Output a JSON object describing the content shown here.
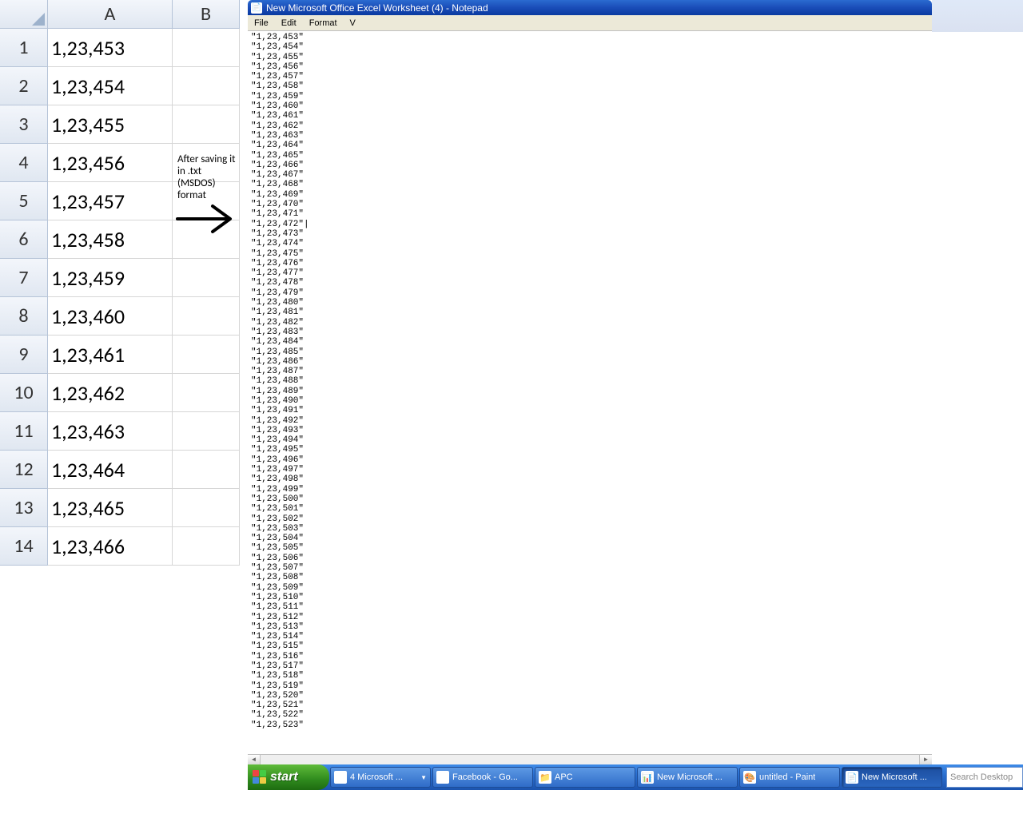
{
  "excel": {
    "columns": [
      "A",
      "B"
    ],
    "rows": [
      {
        "n": "1",
        "A": "1,23,453"
      },
      {
        "n": "2",
        "A": "1,23,454"
      },
      {
        "n": "3",
        "A": "1,23,455"
      },
      {
        "n": "4",
        "A": "1,23,456"
      },
      {
        "n": "5",
        "A": "1,23,457"
      },
      {
        "n": "6",
        "A": "1,23,458"
      },
      {
        "n": "7",
        "A": "1,23,459"
      },
      {
        "n": "8",
        "A": "1,23,460"
      },
      {
        "n": "9",
        "A": "1,23,461"
      },
      {
        "n": "10",
        "A": "1,23,462"
      },
      {
        "n": "11",
        "A": "1,23,463"
      },
      {
        "n": "12",
        "A": "1,23,464"
      },
      {
        "n": "13",
        "A": "1,23,465"
      },
      {
        "n": "14",
        "A": "1,23,466"
      }
    ]
  },
  "annotation": "After saving it in .txt (MSDOS) format",
  "notepad": {
    "title": "New Microsoft Office Excel Worksheet (4) - Notepad",
    "menu": [
      "File",
      "Edit",
      "Format",
      "V"
    ],
    "lines_start": 453,
    "lines_end": 523,
    "cursor_after": 472
  },
  "taskbar": {
    "start": "start",
    "items": [
      {
        "label": "4 Microsoft ...",
        "icon": "🗔",
        "arrow": true
      },
      {
        "label": "Facebook - Go...",
        "icon": "◎"
      },
      {
        "label": "APC",
        "icon": "📁"
      },
      {
        "label": "New Microsoft ...",
        "icon": "📊"
      },
      {
        "label": "untitled - Paint",
        "icon": "🎨"
      },
      {
        "label": "New Microsoft ...",
        "icon": "📄",
        "active": true
      }
    ],
    "search_placeholder": "Search Desktop"
  }
}
